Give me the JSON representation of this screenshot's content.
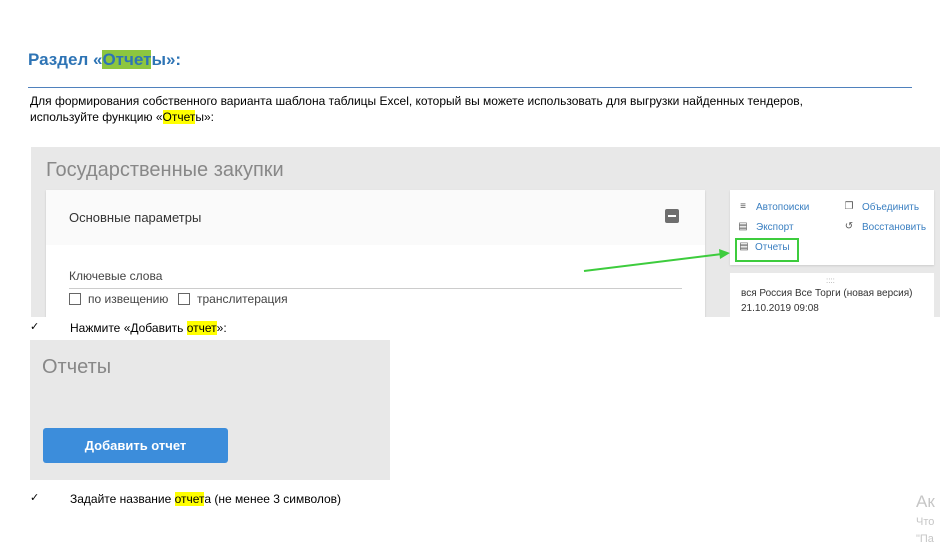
{
  "heading": {
    "prefix": "Раздел «",
    "highlight": "Отчет",
    "suffix": "ы»:"
  },
  "intro": {
    "line1": "Для формирования собственного варианта шаблона таблицы Excel, который вы можете использовать для выгрузки найденных тендеров,",
    "line2_prefix": "используйте функцию «",
    "line2_highlight": "Отчет",
    "line2_suffix": "ы»:"
  },
  "screenshot1": {
    "title": "Государственные закупки",
    "params_title": "Основные параметры",
    "keywords_label": "Ключевые слова",
    "checkbox1": "по извещению",
    "checkbox2": "транслитерация",
    "menu": {
      "autosearch": "Автопоиски",
      "unite": "Объединить",
      "export": "Экспорт",
      "restore": "Восстановить",
      "reports": "Отчеты"
    },
    "tender": {
      "name": "вся Россия Все Торги (новая версия)",
      "date": "21.10.2019 09:08"
    }
  },
  "step1": {
    "check": "✓",
    "prefix": "Нажмите «Добавить ",
    "highlight": "отчет",
    "suffix": "»:"
  },
  "screenshot2": {
    "title": "Отчеты",
    "button": "Добавить отчет"
  },
  "step2": {
    "check": "✓",
    "prefix": "Задайте название ",
    "highlight": "отчет",
    "suffix": "а (не менее 3 символов)"
  },
  "watermark": {
    "line1": "Ак",
    "line2": "Что",
    "line3": "\"Па"
  },
  "colors": {
    "heading": "#2e74b5",
    "highlight_green": "#8dc63f",
    "highlight_yellow": "#ffff00",
    "arrow": "#3dcc3d",
    "button": "#3c8ddb"
  }
}
